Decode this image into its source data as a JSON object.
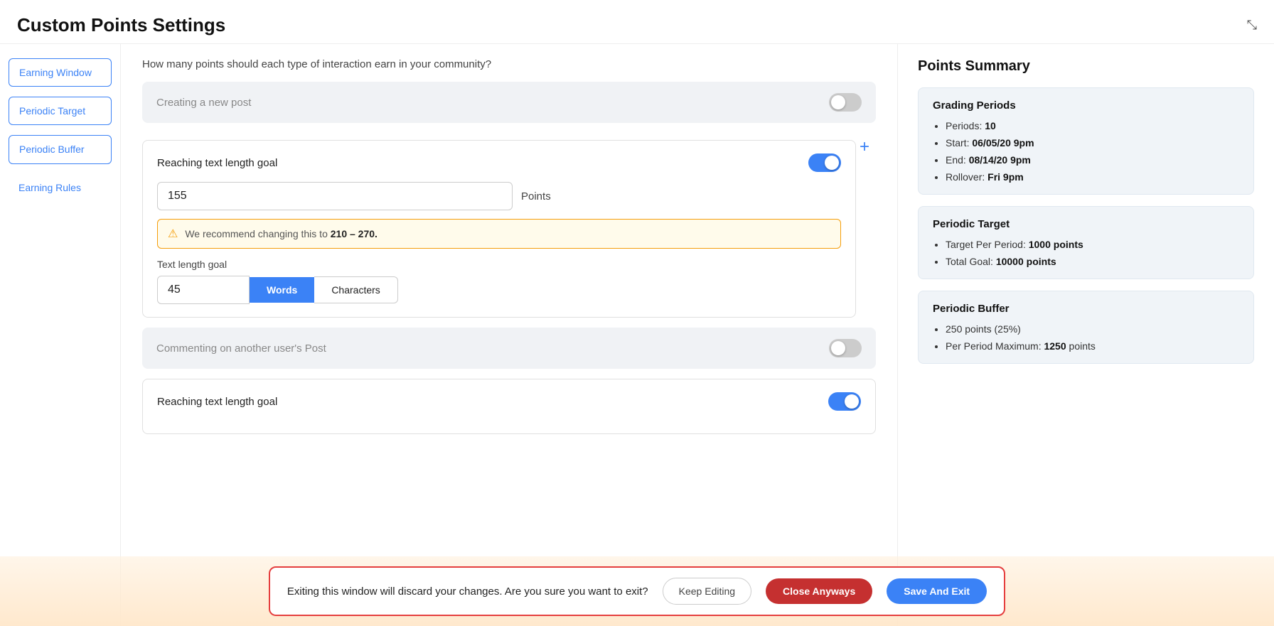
{
  "page": {
    "title": "Custom Points Settings",
    "collapse_icon": "⤡",
    "description": "How many points should each type of interaction earn in your community?"
  },
  "sidebar": {
    "items": [
      {
        "id": "earning-window",
        "label": "Earning Window",
        "active": true
      },
      {
        "id": "periodic-target",
        "label": "Periodic Target",
        "active": true
      },
      {
        "id": "periodic-buffer",
        "label": "Periodic Buffer",
        "active": true
      },
      {
        "id": "earning-rules",
        "label": "Earning Rules",
        "active": false
      }
    ]
  },
  "interactions": [
    {
      "id": "new-post",
      "label": "Creating a new post",
      "enabled": false,
      "has_sub": false
    },
    {
      "id": "text-length",
      "label": "Reaching text length goal",
      "enabled": true,
      "has_sub": true,
      "points_value": "155",
      "points_label": "Points",
      "warning_text": "We recommend changing this to ",
      "warning_range": "210 – 270.",
      "text_length_label": "Text length goal",
      "text_length_value": "45",
      "words_btn": "Words",
      "characters_btn": "Characters"
    },
    {
      "id": "comment-post",
      "label": "Commenting on another user's Post",
      "enabled": false,
      "has_sub": false
    },
    {
      "id": "text-length-2",
      "label": "Reaching text length goal",
      "enabled": true,
      "has_sub": false
    }
  ],
  "plus_btn": "+",
  "summary": {
    "title": "Points Summary",
    "cards": [
      {
        "id": "grading-periods",
        "title": "Grading Periods",
        "items": [
          {
            "label": "Periods: ",
            "value": "10",
            "bold": true
          },
          {
            "label": "Start: ",
            "value": "06/05/20 9pm",
            "bold": true
          },
          {
            "label": "End: ",
            "value": "08/14/20 9pm",
            "bold": true
          },
          {
            "label": "Rollover: ",
            "value": "Fri 9pm",
            "bold": true
          }
        ]
      },
      {
        "id": "periodic-target",
        "title": "Periodic Target",
        "items": [
          {
            "label": "Target Per Period: ",
            "value": "1000 points",
            "bold": true
          },
          {
            "label": "Total Goal: ",
            "value": "10000 points",
            "bold": true
          }
        ]
      },
      {
        "id": "periodic-buffer",
        "title": "Periodic Buffer",
        "items": [
          {
            "label": "250 points (25%)",
            "value": "",
            "bold": false
          },
          {
            "label": "Per Period Maximum: ",
            "value": "1250",
            "bold": true,
            "suffix": " points"
          }
        ]
      }
    ]
  },
  "bottom_bar": {
    "message": "Exiting this window will discard your changes. Are you sure you want to exit?",
    "keep_editing": "Keep Editing",
    "close_anyways": "Close Anyways",
    "save_and_exit": "Save And Exit"
  }
}
